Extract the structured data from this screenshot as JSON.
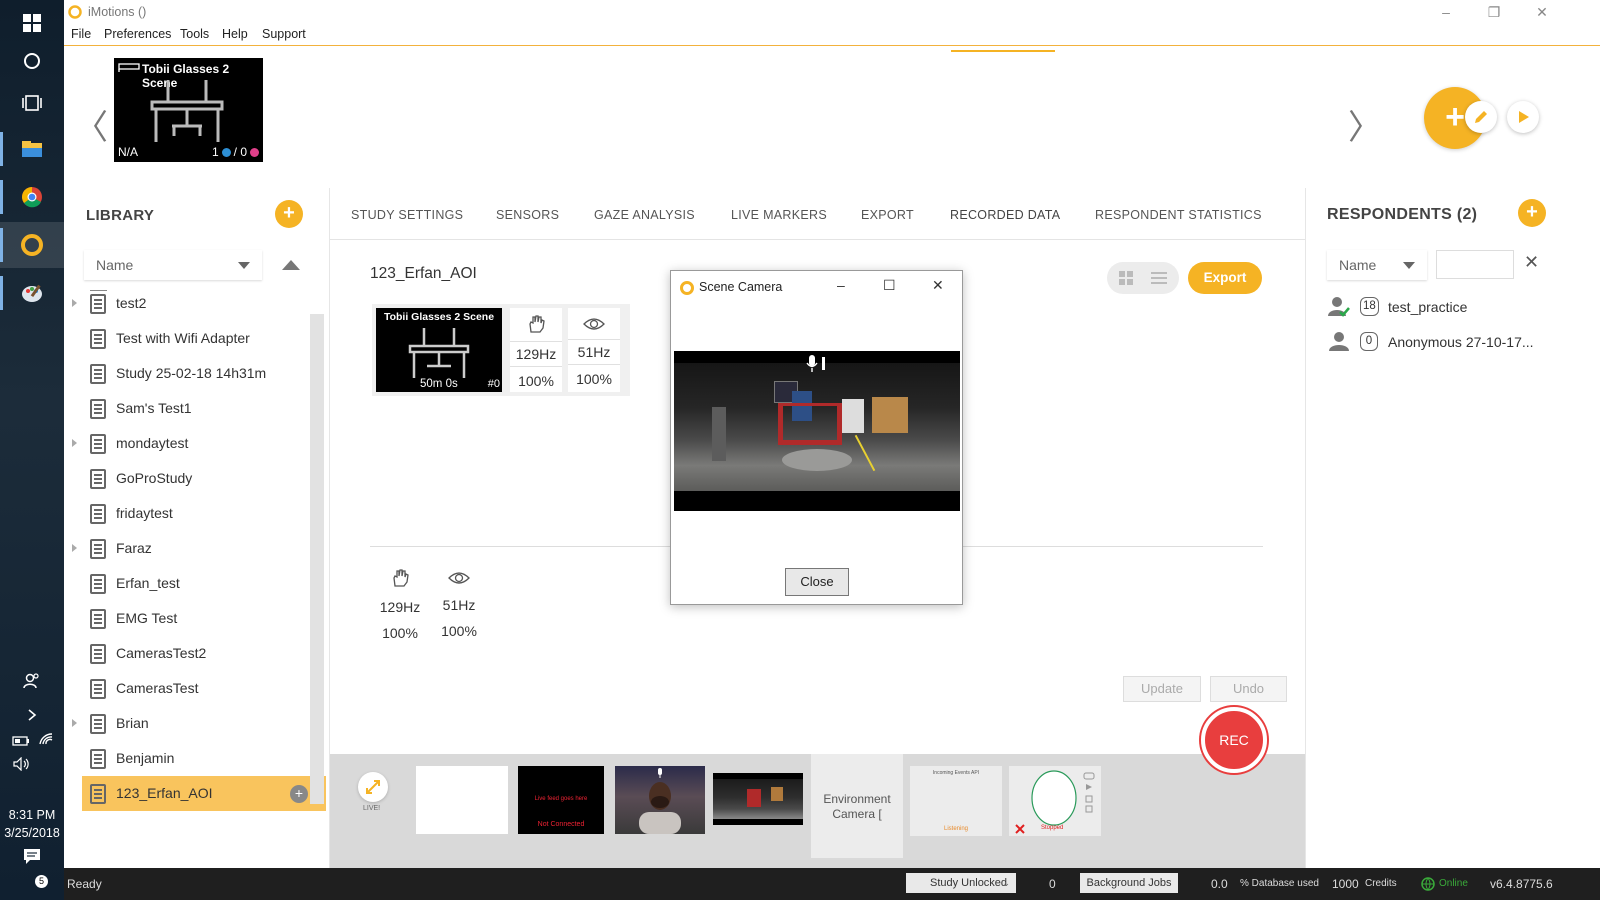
{
  "app": {
    "title": "iMotions ()"
  },
  "window_controls": {
    "minimize": "–",
    "maximize": "❐",
    "close": "✕"
  },
  "menu": [
    "File",
    "Preferences",
    "Tools",
    "Help",
    "Support"
  ],
  "taskbar": {
    "time": "8:31 PM",
    "date": "3/25/2018",
    "notification_count": "5"
  },
  "stimulus": {
    "title": "Tobii Glasses 2 Scene",
    "status": "N/A",
    "count_blue": "1",
    "count_pink": "/ 0"
  },
  "nav": {
    "prev": "〈",
    "next": "〉",
    "add": "+"
  },
  "library": {
    "title": "LIBRARY",
    "add": "+",
    "sort": "Name",
    "items": [
      "test2",
      "Test with Wifi Adapter",
      "Study 25-02-18 14h31m",
      "Sam's Test1",
      "mondaytest",
      "GoProStudy",
      "fridaytest",
      "Faraz",
      "Erfan_test",
      "EMG Test",
      "CamerasTest2",
      "CamerasTest",
      "Brian",
      "Benjamin",
      "123_Erfan_AOI"
    ],
    "selected_add": "+"
  },
  "tabs": [
    "STUDY SETTINGS",
    "SENSORS",
    "GAZE ANALYSIS",
    "LIVE MARKERS",
    "EXPORT",
    "RECORDED DATA",
    "RESPONDENT STATISTICS"
  ],
  "recorded": {
    "respondent": "123_Erfan_AOI",
    "card_title": "Tobii Glasses 2 Scene",
    "duration": "50m 0s",
    "index": "#0",
    "sensor1_hz": "129Hz",
    "sensor1_pct": "100%",
    "sensor2_hz": "51Hz",
    "sensor2_pct": "100%",
    "lower_sensor1_hz": "129Hz",
    "lower_sensor1_pct": "100%",
    "lower_sensor2_hz": "51Hz",
    "lower_sensor2_pct": "100%",
    "export_label": "Export",
    "update_label": "Update",
    "undo_label": "Undo"
  },
  "dialog": {
    "title": "Scene Camera",
    "minimize": "–",
    "maximize": "☐",
    "close": "✕",
    "close_button": "Close"
  },
  "respondents": {
    "title": "RESPONDENTS (2)",
    "add": "+",
    "sort": "Name",
    "clear": "✕",
    "items": [
      {
        "count": "18",
        "name": "test_practice"
      },
      {
        "count": "0",
        "name": "Anonymous 27-10-17..."
      }
    ]
  },
  "bottom": {
    "live": "LIVE!",
    "rec": "REC",
    "live_feed_text": "Live feed goes here",
    "not_connected": "Not Connected",
    "env_camera": "Environment Camera [",
    "incoming_api": "Incoming Events API",
    "listening": "Listening",
    "stopped": "Stopped"
  },
  "status": {
    "ready": "Ready",
    "study_state": "Study Unlocked",
    "jobs_count": "0",
    "jobs_label": "Background Jobs",
    "db_value": "0.0",
    "db_label": "% Database used",
    "credits_value": "1000",
    "credits_label": "Credits",
    "online": "Online",
    "version": "v6.4.8775.6"
  },
  "colors": {
    "accent": "#f5b324",
    "rec": "#e83e3e",
    "selected_row": "#f9c45d",
    "blue_dot": "#2d8fd5",
    "pink_dot": "#e0408a",
    "online": "#3aaa3a"
  }
}
